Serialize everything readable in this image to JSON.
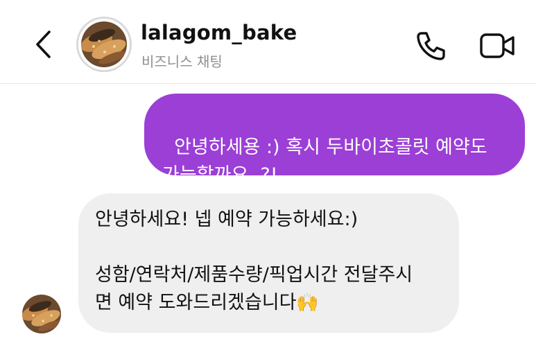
{
  "header": {
    "title": "lalagom_bake",
    "subtitle": "비즈니스 채팅"
  },
  "icons": {
    "back": "chevron-left-icon",
    "call": "phone-icon",
    "video": "video-camera-icon"
  },
  "messages": [
    {
      "from": "me",
      "text": "안녕하세용 :) 혹시 두바이초콜릿 예약도\n가능할까요..?!"
    },
    {
      "from": "lalagom_bake",
      "text": "안녕하세요! 넵 예약 가능하세요:)\n\n성함/연락처/제품수량/픽업시간 전달주시\n면 예약 도와드리겠습니다",
      "emoji": "🙌"
    }
  ],
  "colors": {
    "sent_bubble": "#9b3fd6",
    "received_bubble": "#efefef",
    "subtitle": "#8e8e8e"
  }
}
